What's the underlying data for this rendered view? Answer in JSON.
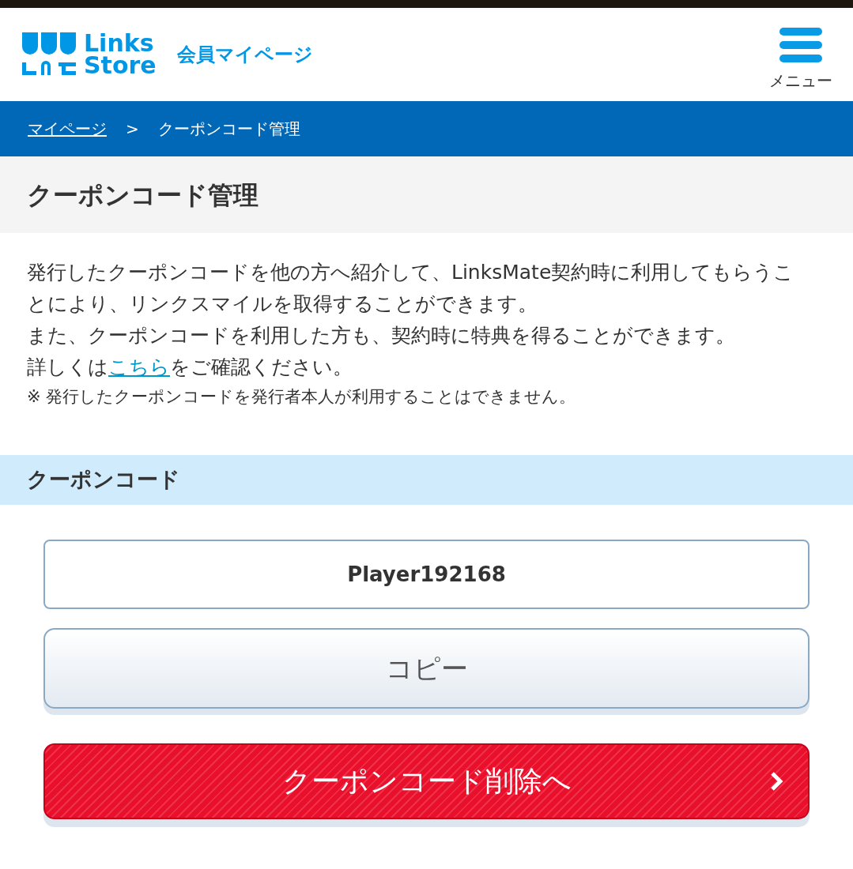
{
  "header": {
    "logo_top": "Links",
    "logo_bottom": "Store",
    "title": "会員マイページ",
    "menu_label": "メニュー"
  },
  "breadcrumb": {
    "items": [
      "マイページ"
    ],
    "separator": ">",
    "current": "クーポンコード管理"
  },
  "page_title": "クーポンコード管理",
  "description": [
    {
      "kind": "text",
      "text": "発行したクーポンコードを他の方へ紹介して、LinksMate契約時に利用してもらうことにより、リンクスマイルを取得することができます。"
    },
    {
      "kind": "text",
      "text": "また、クーポンコードを利用した方も、契約時に特典を得ることができます。"
    },
    {
      "kind": "link",
      "before": "詳しくは",
      "link": "こちら",
      "after": "をご確認ください。"
    }
  ],
  "note": "※ 発行したクーポンコードを発行者本人が利用することはできません。",
  "section_title": "クーポンコード",
  "coupon_code": "Player192168",
  "copy_button": "コピー",
  "delete_button": "クーポンコード削除へ"
}
